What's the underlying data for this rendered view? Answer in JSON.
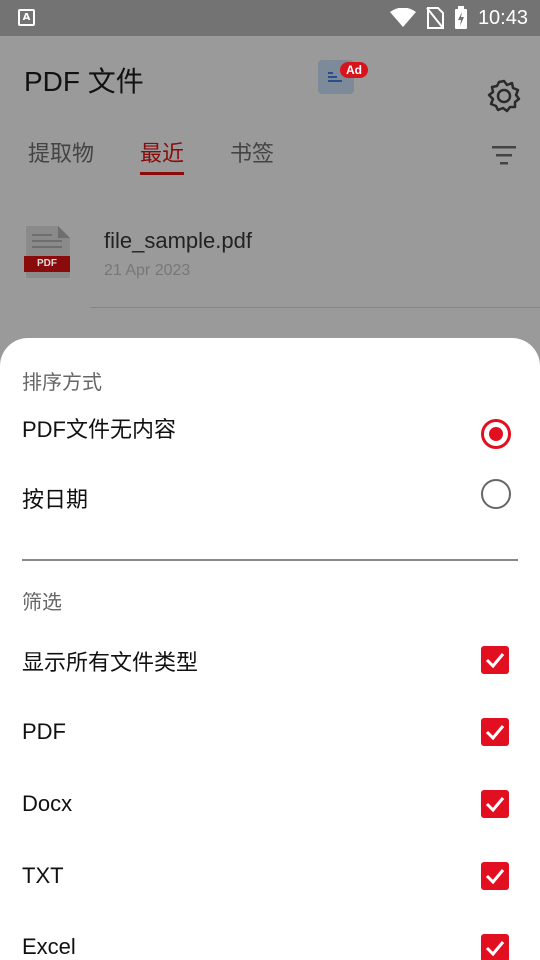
{
  "status_bar": {
    "time": "10:43",
    "left_icon": "A"
  },
  "app_bar": {
    "title": "PDF 文件",
    "ad_badge": "Ad"
  },
  "tabs": [
    {
      "label": "提取物",
      "active": false
    },
    {
      "label": "最近",
      "active": true
    },
    {
      "label": "书签",
      "active": false
    }
  ],
  "files": [
    {
      "name": "file_sample.pdf",
      "date": "21 Apr 2023",
      "thumb_label": "PDF"
    }
  ],
  "sheet": {
    "sort_title": "排序方式",
    "sort_options": [
      {
        "label": "PDF文件无内容",
        "selected": true
      },
      {
        "label": "按日期",
        "selected": false
      }
    ],
    "filter_title": "筛选",
    "filter_options": [
      {
        "label": "显示所有文件类型",
        "checked": true
      },
      {
        "label": "PDF",
        "checked": true
      },
      {
        "label": "Docx",
        "checked": true
      },
      {
        "label": "TXT",
        "checked": true
      },
      {
        "label": "Excel",
        "checked": true
      }
    ]
  },
  "colors": {
    "accent": "#e10f1f",
    "tab_active": "#8a0b0b"
  }
}
